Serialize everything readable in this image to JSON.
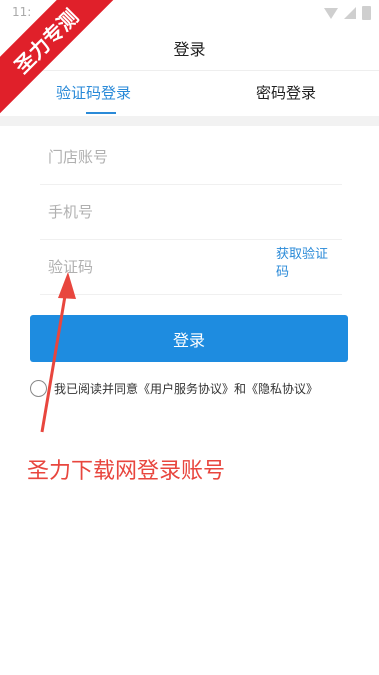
{
  "status_bar": {
    "time": "11:"
  },
  "header": {
    "title": "登录"
  },
  "tabs": [
    {
      "label": "验证码登录",
      "active": true
    },
    {
      "label": "密码登录",
      "active": false
    }
  ],
  "form": {
    "store_account_placeholder": "门店账号",
    "phone_placeholder": "手机号",
    "code_placeholder": "验证码",
    "get_code_label": "获取验证码",
    "login_button": "登录"
  },
  "agreement": {
    "text": "我已阅读并同意《用户服务协议》和《隐私协议》",
    "checked": false
  },
  "overlay": {
    "corner_watermark": "圣力专测",
    "annotation": "圣力下载网登录账号"
  },
  "colors": {
    "accent": "#1e8ce0",
    "annotation": "#e8463e",
    "watermark": "#e0202a"
  }
}
